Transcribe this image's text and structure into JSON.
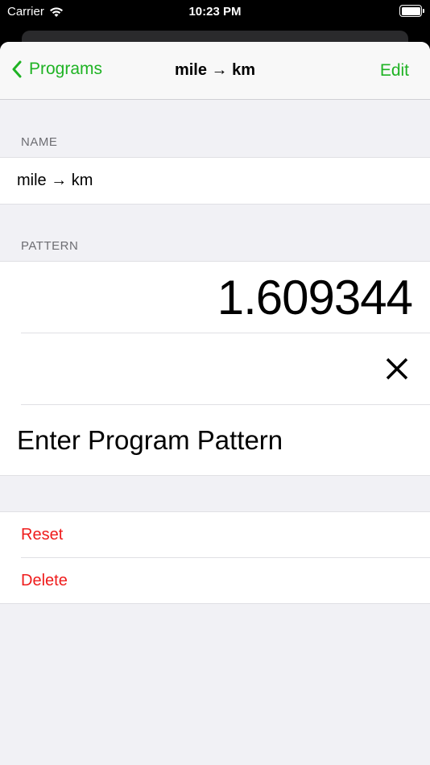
{
  "status_bar": {
    "carrier": "Carrier",
    "time": "10:23 PM",
    "wifi_icon": "wifi-icon",
    "battery_icon": "battery-icon"
  },
  "nav": {
    "back_label": "Programs",
    "back_icon": "chevron-left-icon",
    "title": "mile → km",
    "edit_label": "Edit"
  },
  "name_section": {
    "header": "NAME",
    "value": "mile → km"
  },
  "pattern_section": {
    "header": "PATTERN",
    "value": "1.609344",
    "operator_icon": "multiply-icon",
    "enter_label": "Enter Program Pattern"
  },
  "actions": {
    "reset_label": "Reset",
    "delete_label": "Delete"
  },
  "colors": {
    "accent": "#1fb324",
    "destructive": "#ef1b1b",
    "background": "#f1f1f5"
  }
}
